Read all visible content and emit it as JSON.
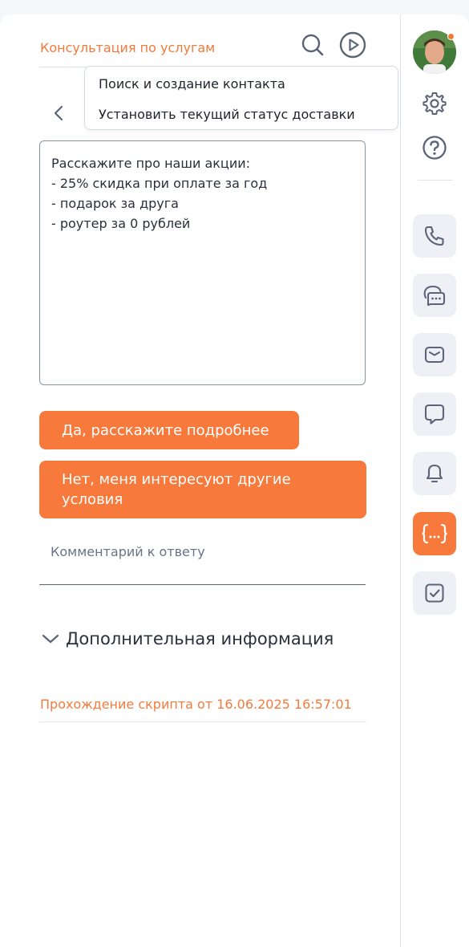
{
  "header": {
    "script_title": "Консультация по услугам"
  },
  "dropdown": {
    "items": [
      "Поиск и создание контакта",
      "Установить текущий статус доставки"
    ]
  },
  "script": {
    "text": "Расскажите про наши акции:\n- 25% скидка при оплате за год\n- подарок за друга\n- роутер за 0 рублей"
  },
  "answers": [
    "Да, расскажите подробнее",
    "Нет, меня интересуют другие условия"
  ],
  "comment": {
    "placeholder": "Комментарий к ответу"
  },
  "extra_info": {
    "label": "Дополнительная информация"
  },
  "run_info": "Прохождение скрипта от 16.06.2025 16:57:01",
  "rail": {
    "icons": [
      "settings-icon",
      "help-icon",
      "phone-icon",
      "chat-icon",
      "mail-icon",
      "message-icon",
      "bell-icon",
      "script-icon",
      "task-icon"
    ],
    "active": "script-icon"
  },
  "colors": {
    "accent": "#f7793c",
    "text": "#2a2f3a",
    "icon": "#5b6478",
    "tile": "#eef0f5"
  }
}
